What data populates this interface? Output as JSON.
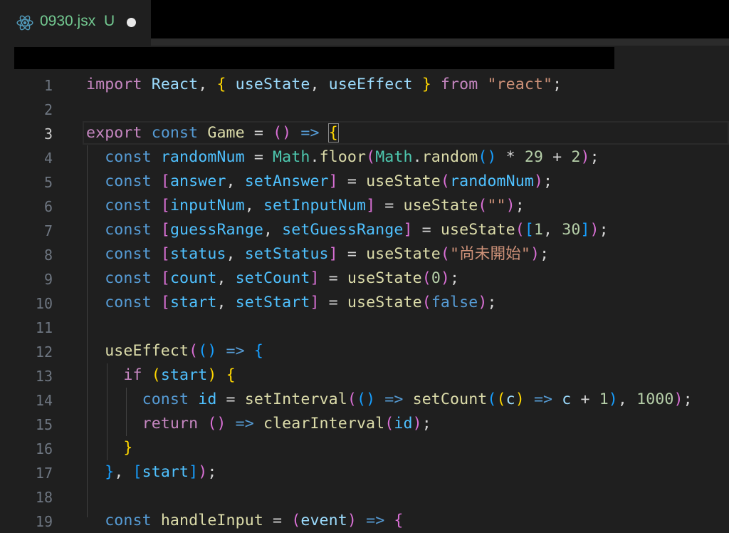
{
  "tab": {
    "filename": "0930.jsx",
    "status": "U",
    "icon": "react-icon",
    "label_color": "#73c991"
  },
  "editor": {
    "active_line": 3,
    "lines": [
      {
        "n": "1"
      },
      {
        "n": "2"
      },
      {
        "n": "3"
      },
      {
        "n": "4"
      },
      {
        "n": "5"
      },
      {
        "n": "6"
      },
      {
        "n": "7"
      },
      {
        "n": "8"
      },
      {
        "n": "9"
      },
      {
        "n": "10"
      },
      {
        "n": "11"
      },
      {
        "n": "12"
      },
      {
        "n": "13"
      },
      {
        "n": "14"
      },
      {
        "n": "15"
      },
      {
        "n": "16"
      },
      {
        "n": "17"
      },
      {
        "n": "18"
      },
      {
        "n": "19"
      }
    ],
    "tokens": {
      "l1": [
        "import",
        "React",
        "useState",
        "useEffect",
        "from",
        "\"react\""
      ],
      "l3": [
        "export",
        "const",
        "Game"
      ],
      "l4": [
        "const",
        "randomNum",
        "Math",
        "floor",
        "Math",
        "random",
        "29",
        "2"
      ],
      "l5": [
        "const",
        "answer",
        "setAnswer",
        "useState",
        "randomNum"
      ],
      "l6": [
        "const",
        "inputNum",
        "setInputNum",
        "useState",
        "\"\""
      ],
      "l7": [
        "const",
        "guessRange",
        "setGuessRange",
        "useState",
        "1",
        "30"
      ],
      "l8": [
        "const",
        "status",
        "setStatus",
        "useState",
        "\"尚未開始\""
      ],
      "l9": [
        "const",
        "count",
        "setCount",
        "useState",
        "0"
      ],
      "l10": [
        "const",
        "start",
        "setStart",
        "useState",
        "false"
      ],
      "l12": [
        "useEffect"
      ],
      "l13": [
        "if",
        "start"
      ],
      "l14": [
        "const",
        "id",
        "setInterval",
        "setCount",
        "c",
        "c",
        "1",
        "1000"
      ],
      "l15": [
        "return",
        "clearInterval",
        "id"
      ],
      "l17": [
        "start"
      ],
      "l19": [
        "const",
        "handleInput",
        "event"
      ]
    }
  }
}
